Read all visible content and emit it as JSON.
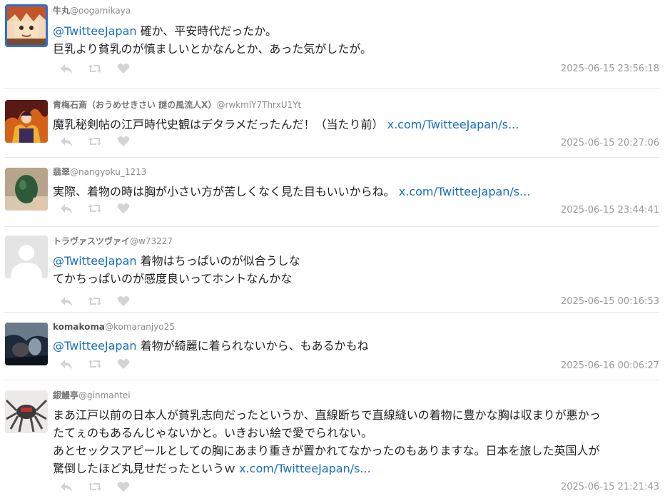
{
  "tweets": [
    {
      "name": "牛丸",
      "handle": "@oogamikaya",
      "lines": [
        {
          "mention": "@TwitteeJapan",
          "text": " 確か、平安時代だったか。",
          "link": ""
        },
        {
          "mention": "",
          "text": "巨乳より貧乳のが慎ましいとかなんとか、あった気がしたが。",
          "link": ""
        }
      ],
      "time": "2025-06-15 23:56:18",
      "avatar": "anime-character-avatar"
    },
    {
      "name": "青梅石斎（おうめせきさい 謎の風流人X）",
      "handle": "@rwkmlY7ThrxU1Yt",
      "lines": [
        {
          "mention": "",
          "text": "魔乳秘剣帖の江戸時代史観はデタラメだったんだ！（当たり前） ",
          "link": "x.com/TwitteeJapan/s..."
        }
      ],
      "time": "2025-06-15 20:27:06",
      "avatar": "fiery-figure-avatar"
    },
    {
      "name": "翡翠",
      "handle": "@nangyoku_1213",
      "lines": [
        {
          "mention": "",
          "text": "実際、着物の時は胸が小さい方が苦しくなく見た目もいいからね。 ",
          "link": "x.com/TwitteeJapan/s..."
        }
      ],
      "time": "2025-06-15 23:44:41",
      "avatar": "jade-stone-avatar"
    },
    {
      "name": "トラヴァスツヴァイ",
      "handle": "@w73227",
      "lines": [
        {
          "mention": "@TwitteeJapan",
          "text": " 着物はちっぱいのが似合うしな",
          "link": ""
        },
        {
          "mention": "",
          "text": "てかちっぱいのが感度良いってホントなんかな",
          "link": ""
        }
      ],
      "time": "2025-06-15 00:16:53",
      "avatar": "default-user-avatar"
    },
    {
      "name": "komakoma",
      "handle": "@komaranjyo25",
      "lines": [
        {
          "mention": "@TwitteeJapan",
          "text": " 着物が綺麗に着られないから、もあるかもね",
          "link": ""
        }
      ],
      "time": "2025-06-16 00:06:27",
      "avatar": "night-scene-avatar"
    },
    {
      "name": "銀鰻亭",
      "handle": "@ginmantei",
      "lines": [
        {
          "mention": "",
          "text": "まあ江戸以前の日本人が貧乳志向だったというか、直線断ちで直線縫いの着物に豊かな胸は収まりが悪かっ",
          "link": ""
        },
        {
          "mention": "",
          "text": "たてぇのもあるんじゃないかと。いきおい絵で愛でられない。",
          "link": ""
        },
        {
          "mention": "",
          "text": "あとセックスアピールとしての胸にあまり重きが置かれてなかったのもありますな。日本を旅した英国人が",
          "link": ""
        },
        {
          "mention": "",
          "text": "驚倒したほど丸見せだったというｗ ",
          "link": "x.com/TwitteeJapan/s..."
        }
      ],
      "time": "2025-06-15 21:21:43",
      "avatar": "spider-robot-avatar"
    }
  ],
  "actions": {
    "reply": "reply-icon",
    "retweet": "retweet-icon",
    "like": "heart-icon"
  },
  "colors": {
    "link": "#1a6fc2",
    "meta": "#9a9a9a",
    "icon": "#d4d4d4",
    "divider": "#e6e6e6"
  }
}
